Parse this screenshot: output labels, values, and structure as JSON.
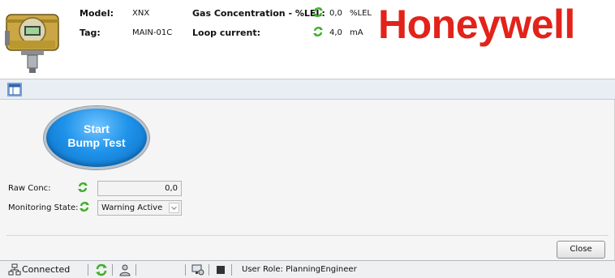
{
  "header": {
    "model_label": "Model:",
    "model_value": "XNX",
    "tag_label": "Tag:",
    "tag_value": "MAIN-01C",
    "gas_label": "Gas Concentration - %LEL:",
    "gas_value": "0,0",
    "gas_unit": "%LEL",
    "loop_label": "Loop current:",
    "loop_value": "4,0",
    "loop_unit": "mA",
    "brand": "Honeywell"
  },
  "main": {
    "bump_line1": "Start",
    "bump_line2": "Bump Test",
    "raw_label": "Raw Conc:",
    "raw_value": "0,0",
    "monitoring_label": "Monitoring State:",
    "monitoring_value": "Warning Active",
    "close_label": "Close"
  },
  "status": {
    "connected": "Connected",
    "user_role": "User Role: PlanningEngineer"
  },
  "colors": {
    "brand_red": "#e2231a",
    "bump_blue": "#1f93ea",
    "refresh_green": "#3fae2a"
  },
  "icons": [
    "device-image",
    "refresh-icon",
    "panel-icon",
    "network-icon",
    "user-icon",
    "monitor-icon",
    "stop-icon"
  ]
}
